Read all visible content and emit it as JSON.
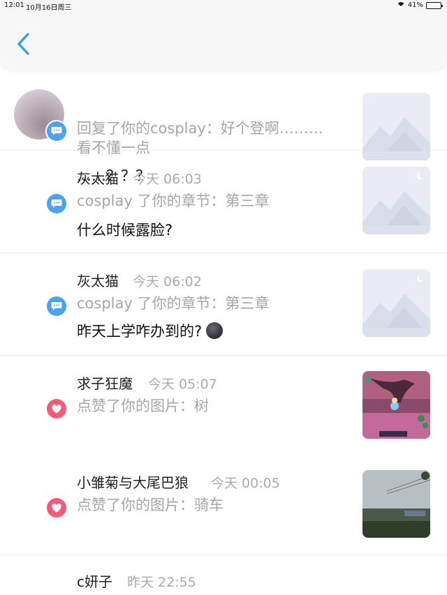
{
  "status_bar": {
    "time": "12:01",
    "date": "10月16日周三",
    "battery": "41%",
    "battery_level": 0.41
  },
  "nav": {
    "back_icon": "chevron-left-icon"
  },
  "items": [
    {
      "type": "comment",
      "name": "",
      "time": "",
      "action_line1": "回复了你的cosplay：好个登啊………",
      "action_line2": "看不懂一点",
      "comment": "……？？？",
      "thumb": "placeholder"
    },
    {
      "type": "comment",
      "name": "灰太猫",
      "time": "今天 06:03",
      "action_line1": "cosplay 了你的章节：第三章",
      "comment": "什么时候露脸?",
      "thumb": "placeholder"
    },
    {
      "type": "comment",
      "name": "灰太猫",
      "time": "今天 06:02",
      "action_line1": "cosplay 了你的章节：第三章",
      "comment": "昨天上学咋办到的?",
      "thumb": "placeholder"
    },
    {
      "type": "like",
      "name": "求子狂魔",
      "time": "今天 05:07",
      "action_line1": "点赞了你的图片：树",
      "thumb": "game-screenshot"
    },
    {
      "type": "like",
      "name": "小雏菊与大尾巴狼",
      "time": "今天 00:05",
      "action_line1": "点赞了你的图片：骑车",
      "thumb": "landscape-photo"
    },
    {
      "type": "comment",
      "name": "c妍子",
      "time": "昨天 22:55"
    }
  ],
  "colors": {
    "accent": "#3a9be8",
    "comment_badge": "#4aa3f0",
    "like_badge": "#f25a77"
  }
}
